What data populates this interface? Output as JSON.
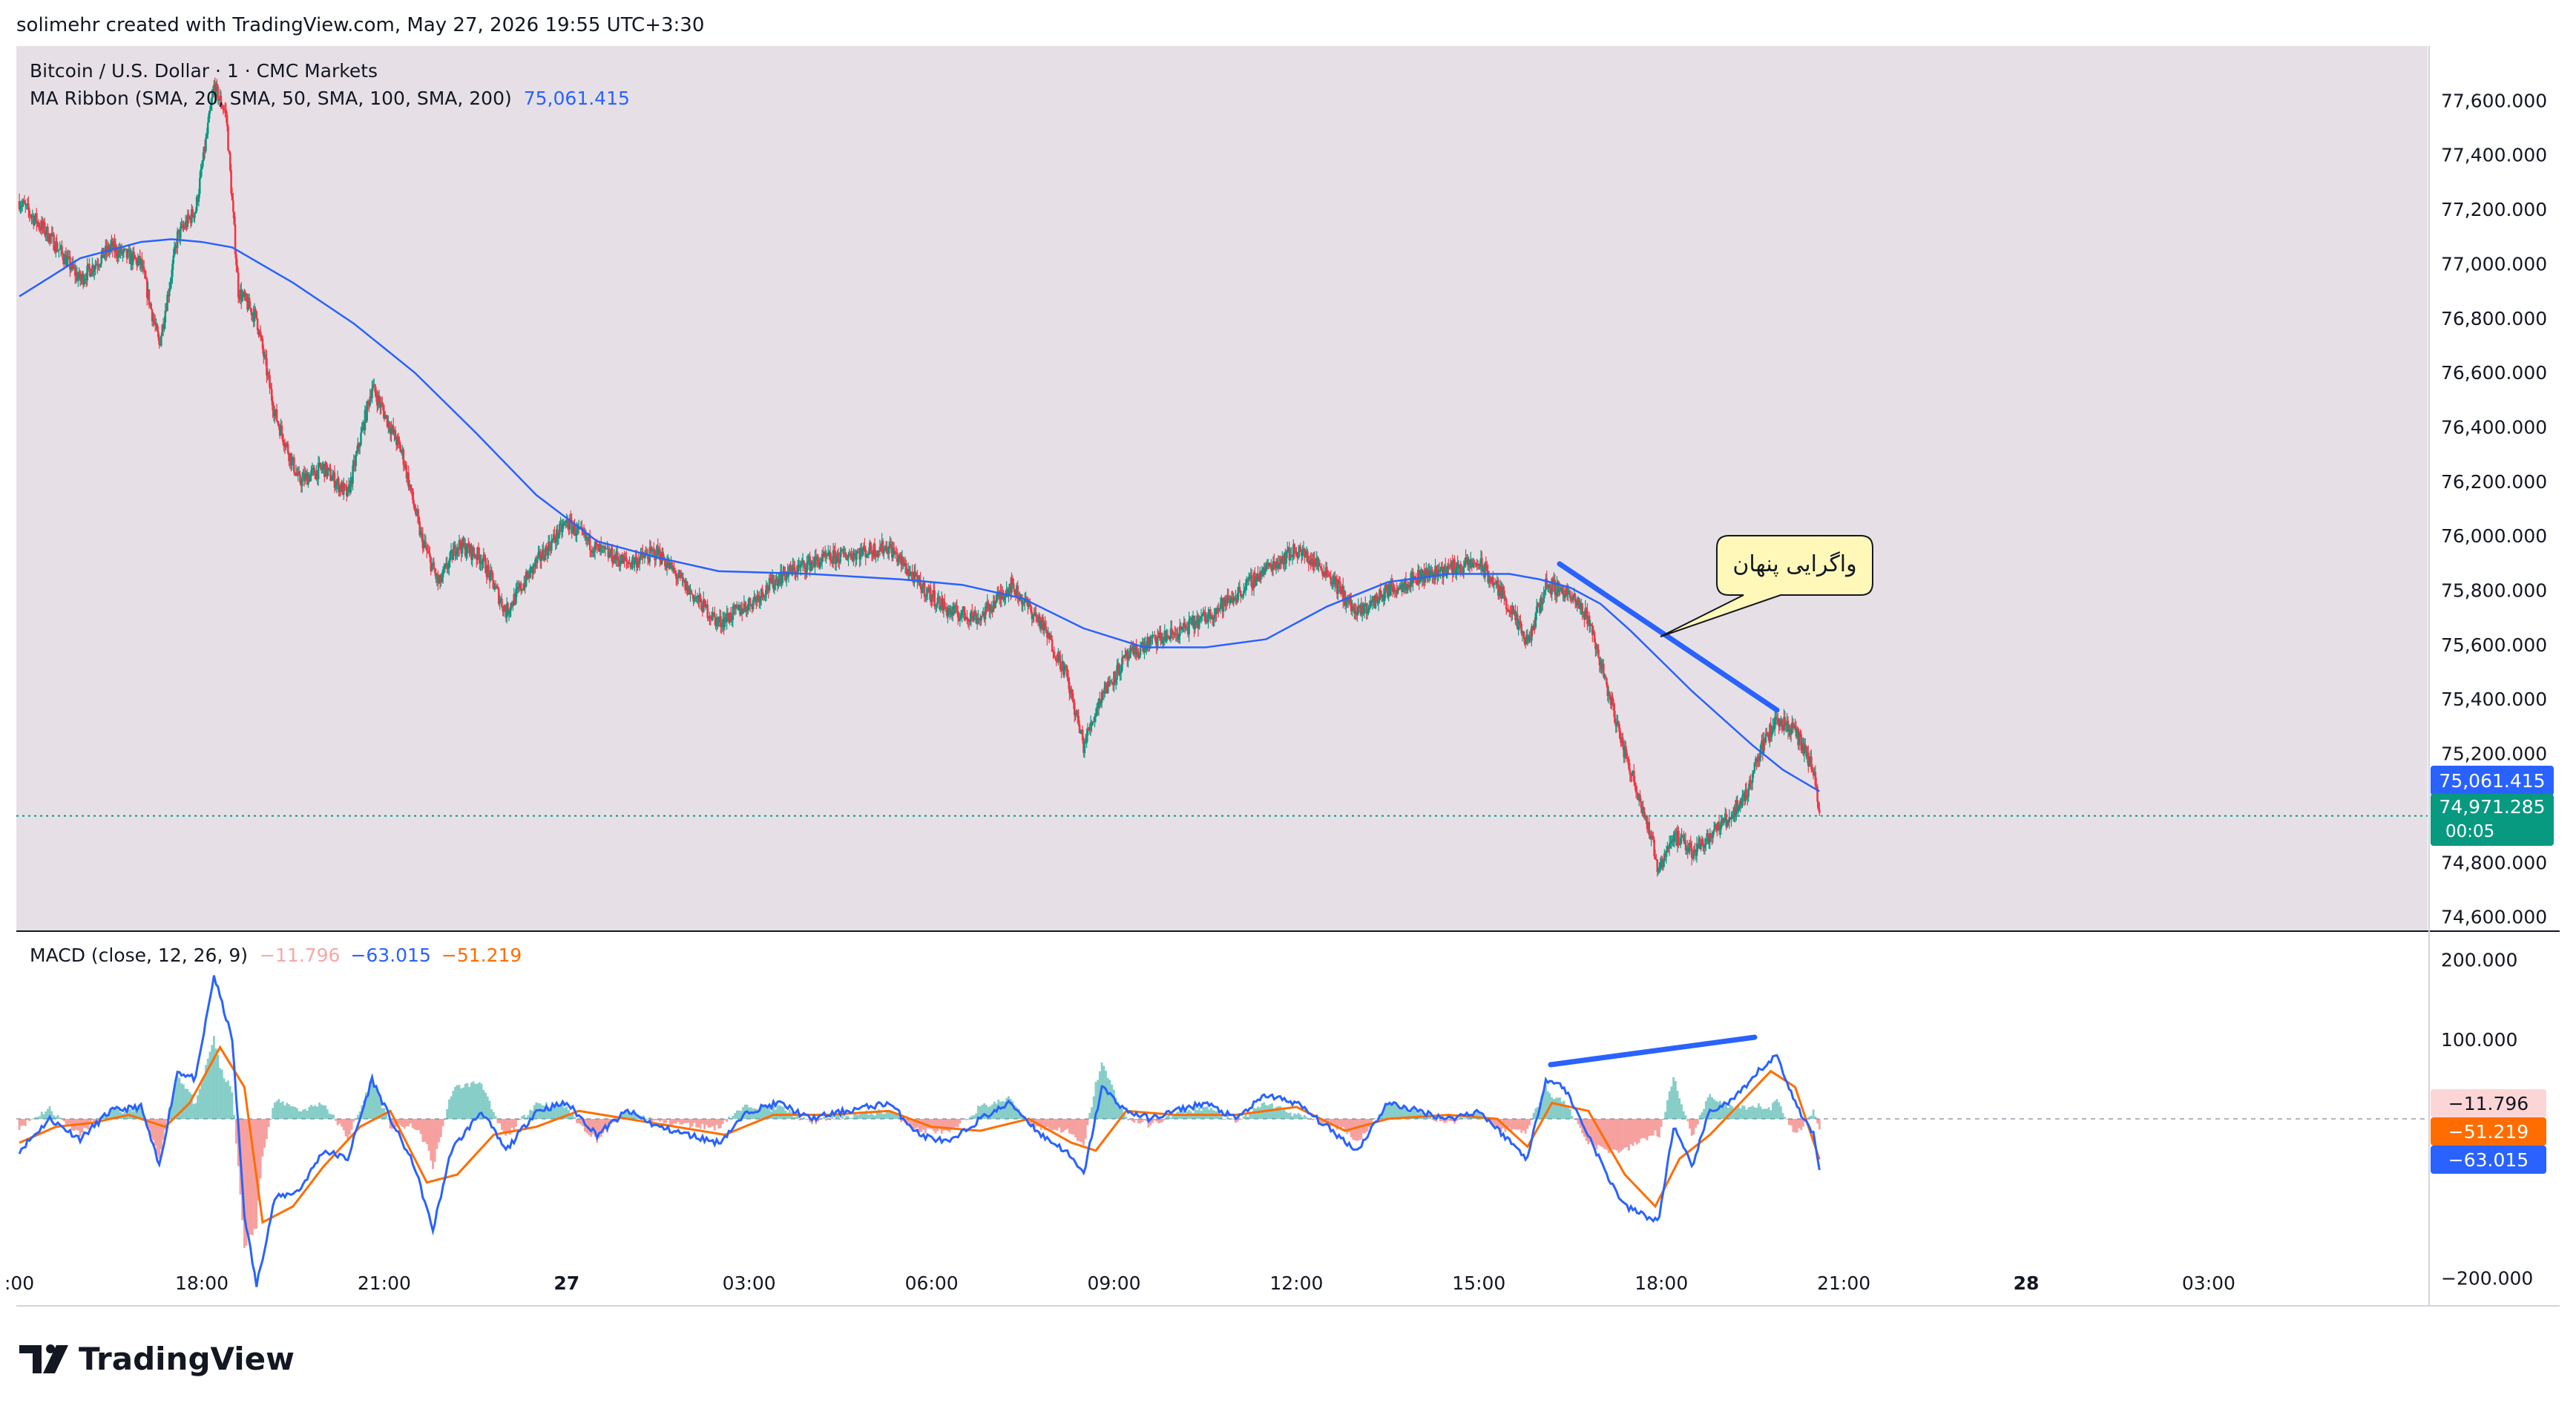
{
  "header": {
    "attribution": "solimehr created with TradingView.com, May 27, 2026 19:55 UTC+3:30"
  },
  "legend": {
    "symbol": "Bitcoin / U.S. Dollar · 1 · CMC Markets",
    "ma_label": "MA Ribbon (SMA, 20, SMA, 50, SMA, 100, SMA, 200)",
    "ma_value": "75,061.415",
    "macd_label": "MACD (close, 12, 26, 9)",
    "macd_hist": "−11.796",
    "macd_line": "−63.015",
    "macd_signal": "−51.219"
  },
  "annotation": {
    "text": "واگرایی پنهان"
  },
  "price_tags": {
    "ma": "75,061.415",
    "last": "74,971.285",
    "countdown": "00:05"
  },
  "macd_tags": {
    "hist": "−11.796",
    "signal": "−51.219",
    "macd": "−63.015"
  },
  "brand": {
    "name": "TradingView"
  },
  "colors": {
    "panel_bg": "#e6e0e6",
    "up": "#089981",
    "down": "#f23645",
    "ma": "#2962ff",
    "macd": "#2962ff",
    "signal": "#ff6d00",
    "trendline": "#2962ff",
    "callout_bg": "#fff8b8",
    "last_price_bg": "#089981"
  },
  "chart_data": [
    {
      "type": "candlestick",
      "title": "Bitcoin / U.S. Dollar · 1 · CMC Markets",
      "x_tick_labels": [
        ":00",
        "18:00",
        "21:00",
        "27",
        "03:00",
        "06:00",
        "09:00",
        "12:00",
        "15:00",
        "18:00",
        "21:00",
        "28",
        "03:00"
      ],
      "x_tick_hours": [
        15,
        18,
        21,
        24,
        27,
        30,
        33,
        36,
        39,
        42,
        45,
        48,
        51
      ],
      "xlim_hours": [
        14.95,
        54.6
      ],
      "y_tick_labels": [
        "74,600.000",
        "74,800.000",
        "75,200.000",
        "75,400.000",
        "75,600.000",
        "75,800.000",
        "76,000.000",
        "76,200.000",
        "76,400.000",
        "76,600.000",
        "76,800.000",
        "77,000.000",
        "77,200.000",
        "77,400.000",
        "77,600.000"
      ],
      "y_tick_values": [
        74600,
        74800,
        75200,
        75400,
        75600,
        75800,
        76000,
        76200,
        76400,
        76600,
        76800,
        77000,
        77200,
        77400,
        77600
      ],
      "ylim": [
        74550,
        77800
      ],
      "close_path": [
        [
          15.0,
          77230
        ],
        [
          15.5,
          77100
        ],
        [
          16.0,
          76940
        ],
        [
          16.5,
          77060
        ],
        [
          17.0,
          77000
        ],
        [
          17.3,
          76700
        ],
        [
          17.6,
          77100
        ],
        [
          17.9,
          77200
        ],
        [
          18.2,
          77650
        ],
        [
          18.4,
          77550
        ],
        [
          18.6,
          76900
        ],
        [
          18.9,
          76800
        ],
        [
          19.2,
          76450
        ],
        [
          19.6,
          76200
        ],
        [
          20.0,
          76250
        ],
        [
          20.4,
          76150
        ],
        [
          20.8,
          76550
        ],
        [
          21.0,
          76450
        ],
        [
          21.3,
          76300
        ],
        [
          21.6,
          76000
        ],
        [
          21.9,
          75820
        ],
        [
          22.2,
          75970
        ],
        [
          22.6,
          75920
        ],
        [
          23.0,
          75720
        ],
        [
          23.5,
          75900
        ],
        [
          24.0,
          76050
        ],
        [
          24.5,
          75950
        ],
        [
          25.0,
          75900
        ],
        [
          25.5,
          75940
        ],
        [
          26.0,
          75800
        ],
        [
          26.5,
          75680
        ],
        [
          27.0,
          75750
        ],
        [
          27.5,
          75850
        ],
        [
          28.0,
          75900
        ],
        [
          28.6,
          75930
        ],
        [
          29.3,
          75960
        ],
        [
          29.8,
          75820
        ],
        [
          30.3,
          75720
        ],
        [
          30.8,
          75700
        ],
        [
          31.3,
          75820
        ],
        [
          31.8,
          75680
        ],
        [
          32.2,
          75500
        ],
        [
          32.5,
          75230
        ],
        [
          32.8,
          75420
        ],
        [
          33.2,
          75550
        ],
        [
          33.6,
          75610
        ],
        [
          34.0,
          75640
        ],
        [
          34.5,
          75700
        ],
        [
          35.0,
          75780
        ],
        [
          35.5,
          75880
        ],
        [
          36.0,
          75950
        ],
        [
          36.5,
          75870
        ],
        [
          37.0,
          75710
        ],
        [
          37.5,
          75800
        ],
        [
          38.0,
          75850
        ],
        [
          38.5,
          75880
        ],
        [
          39.0,
          75900
        ],
        [
          39.4,
          75780
        ],
        [
          39.8,
          75600
        ],
        [
          40.1,
          75820
        ],
        [
          40.4,
          75800
        ],
        [
          40.8,
          75700
        ],
        [
          41.1,
          75450
        ],
        [
          41.4,
          75200
        ],
        [
          41.7,
          75000
        ],
        [
          41.95,
          74780
        ],
        [
          42.2,
          74900
        ],
        [
          42.5,
          74840
        ],
        [
          42.8,
          74900
        ],
        [
          43.1,
          74960
        ],
        [
          43.4,
          75050
        ],
        [
          43.6,
          75200
        ],
        [
          43.9,
          75330
        ],
        [
          44.2,
          75280
        ],
        [
          44.5,
          75140
        ],
        [
          44.6,
          74971
        ]
      ],
      "annotations": [
        "واگرایی پنهان"
      ]
    },
    {
      "type": "line",
      "series": [
        {
          "name": "MA Ribbon (SMA, 20, SMA, 50, SMA, 100, SMA, 200)",
          "last_value": 75061.415
        }
      ],
      "x": [
        15.0,
        16.0,
        17.0,
        17.5,
        18.0,
        18.5,
        19.5,
        20.5,
        21.5,
        22.5,
        23.5,
        24.5,
        25.5,
        26.5,
        28.0,
        29.5,
        30.5,
        31.5,
        32.5,
        33.5,
        34.5,
        35.5,
        36.5,
        37.5,
        38.5,
        39.5,
        40.0,
        40.5,
        41.0,
        41.5,
        42.0,
        42.5,
        43.0,
        43.5,
        44.0,
        44.6
      ],
      "y": [
        76880,
        77020,
        77080,
        77090,
        77080,
        77060,
        76930,
        76780,
        76600,
        76380,
        76150,
        75980,
        75920,
        75870,
        75860,
        75840,
        75820,
        75770,
        75660,
        75590,
        75590,
        75620,
        75740,
        75830,
        75860,
        75860,
        75840,
        75810,
        75750,
        75650,
        75540,
        75430,
        75330,
        75230,
        75140,
        75061
      ]
    },
    {
      "type": "line",
      "title": "MACD (close, 12, 26, 9)",
      "y_tick_labels": [
        "200.000",
        "100.000",
        "−200.000"
      ],
      "y_tick_values": [
        200,
        100,
        -200
      ],
      "ylim": [
        -235,
        235
      ],
      "series": [
        {
          "name": "MACD",
          "last_value": -63.015
        },
        {
          "name": "Signal",
          "last_value": -51.219
        },
        {
          "name": "Histogram",
          "last_value": -11.796
        }
      ],
      "macd_path": [
        [
          15.0,
          -40
        ],
        [
          15.5,
          0
        ],
        [
          16.0,
          -25
        ],
        [
          16.5,
          10
        ],
        [
          17.0,
          15
        ],
        [
          17.3,
          -60
        ],
        [
          17.6,
          60
        ],
        [
          17.9,
          50
        ],
        [
          18.2,
          180
        ],
        [
          18.5,
          100
        ],
        [
          18.7,
          -120
        ],
        [
          18.9,
          -210
        ],
        [
          19.2,
          -100
        ],
        [
          19.6,
          -90
        ],
        [
          20.0,
          -40
        ],
        [
          20.4,
          -50
        ],
        [
          20.8,
          50
        ],
        [
          21.1,
          0
        ],
        [
          21.5,
          -60
        ],
        [
          21.8,
          -140
        ],
        [
          22.1,
          -40
        ],
        [
          22.6,
          10
        ],
        [
          23.0,
          -40
        ],
        [
          23.5,
          10
        ],
        [
          24.0,
          20
        ],
        [
          24.5,
          -20
        ],
        [
          25.0,
          10
        ],
        [
          25.5,
          -10
        ],
        [
          26.0,
          -20
        ],
        [
          26.5,
          -30
        ],
        [
          27.0,
          10
        ],
        [
          27.5,
          20
        ],
        [
          28.0,
          0
        ],
        [
          28.6,
          10
        ],
        [
          29.3,
          20
        ],
        [
          29.8,
          -20
        ],
        [
          30.3,
          -30
        ],
        [
          30.8,
          0
        ],
        [
          31.3,
          20
        ],
        [
          31.8,
          -20
        ],
        [
          32.2,
          -40
        ],
        [
          32.5,
          -70
        ],
        [
          32.8,
          40
        ],
        [
          33.2,
          10
        ],
        [
          33.6,
          0
        ],
        [
          34.0,
          10
        ],
        [
          34.5,
          20
        ],
        [
          35.0,
          0
        ],
        [
          35.5,
          30
        ],
        [
          36.0,
          20
        ],
        [
          36.5,
          -10
        ],
        [
          37.0,
          -40
        ],
        [
          37.5,
          20
        ],
        [
          38.0,
          10
        ],
        [
          38.5,
          0
        ],
        [
          39.0,
          10
        ],
        [
          39.4,
          -20
        ],
        [
          39.8,
          -50
        ],
        [
          40.1,
          50
        ],
        [
          40.4,
          40
        ],
        [
          40.8,
          -20
        ],
        [
          41.1,
          -70
        ],
        [
          41.4,
          -110
        ],
        [
          41.7,
          -120
        ],
        [
          41.95,
          -130
        ],
        [
          42.2,
          -10
        ],
        [
          42.5,
          -60
        ],
        [
          42.8,
          10
        ],
        [
          43.1,
          20
        ],
        [
          43.4,
          40
        ],
        [
          43.6,
          60
        ],
        [
          43.9,
          80
        ],
        [
          44.2,
          20
        ],
        [
          44.5,
          -20
        ],
        [
          44.6,
          -63
        ]
      ],
      "signal_path": [
        [
          15.0,
          -30
        ],
        [
          15.6,
          -10
        ],
        [
          16.2,
          -5
        ],
        [
          16.8,
          5
        ],
        [
          17.4,
          -10
        ],
        [
          17.8,
          20
        ],
        [
          18.3,
          90
        ],
        [
          18.7,
          40
        ],
        [
          19.0,
          -130
        ],
        [
          19.5,
          -110
        ],
        [
          20.0,
          -60
        ],
        [
          20.6,
          -10
        ],
        [
          21.1,
          10
        ],
        [
          21.7,
          -80
        ],
        [
          22.2,
          -70
        ],
        [
          22.8,
          -20
        ],
        [
          23.5,
          -10
        ],
        [
          24.2,
          10
        ],
        [
          25.0,
          0
        ],
        [
          25.8,
          -10
        ],
        [
          26.6,
          -20
        ],
        [
          27.4,
          5
        ],
        [
          28.3,
          5
        ],
        [
          29.3,
          10
        ],
        [
          30.0,
          -10
        ],
        [
          30.8,
          -15
        ],
        [
          31.6,
          0
        ],
        [
          32.3,
          -30
        ],
        [
          32.7,
          -40
        ],
        [
          33.2,
          10
        ],
        [
          34.0,
          5
        ],
        [
          35.0,
          5
        ],
        [
          36.0,
          15
        ],
        [
          36.8,
          -15
        ],
        [
          37.5,
          0
        ],
        [
          38.5,
          5
        ],
        [
          39.3,
          0
        ],
        [
          39.8,
          -35
        ],
        [
          40.2,
          20
        ],
        [
          40.8,
          10
        ],
        [
          41.4,
          -70
        ],
        [
          41.9,
          -110
        ],
        [
          42.3,
          -50
        ],
        [
          42.8,
          -20
        ],
        [
          43.3,
          20
        ],
        [
          43.8,
          60
        ],
        [
          44.2,
          40
        ],
        [
          44.6,
          -51
        ]
      ]
    }
  ]
}
